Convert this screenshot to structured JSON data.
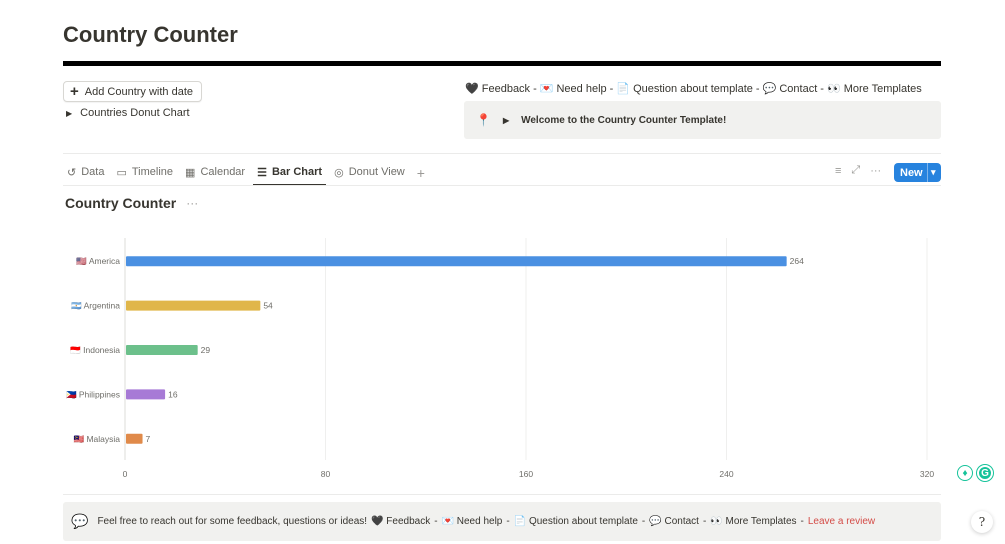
{
  "page": {
    "title": "Country Counter"
  },
  "actions": {
    "add_label": "Add Country with date",
    "toggle_label": "Countries Donut Chart"
  },
  "links": {
    "feedback": "🖤 Feedback",
    "need_help": "💌 Need help",
    "question": "📄 Question about template",
    "contact": "💬 Contact",
    "more_templates": "👀 More Templates",
    "separator": "-"
  },
  "callout_top": {
    "text": "Welcome to the Country Counter Template!"
  },
  "tabs": [
    {
      "label": "Data",
      "icon": "history-icon"
    },
    {
      "label": "Timeline",
      "icon": "timeline-icon"
    },
    {
      "label": "Calendar",
      "icon": "calendar-icon"
    },
    {
      "label": "Bar Chart",
      "icon": "bar-chart-icon"
    },
    {
      "label": "Donut View",
      "icon": "donut-icon"
    }
  ],
  "toolbar": {
    "new_label": "New"
  },
  "database": {
    "title": "Country Counter"
  },
  "chart_data": {
    "type": "bar",
    "orientation": "horizontal",
    "categories": [
      "🇺🇸 America",
      "🇦🇷 Argentina",
      "🇮🇩 Indonesia",
      "🇵🇭 Philippines",
      "🇲🇾 Malaysia"
    ],
    "values": [
      264,
      54,
      29,
      16,
      7
    ],
    "colors": [
      "#4a90e2",
      "#e0b64a",
      "#6cc08b",
      "#a77ad6",
      "#e08a4a"
    ],
    "xticks": [
      "0",
      "80",
      "160",
      "240",
      "320"
    ],
    "xlim": [
      0,
      320
    ],
    "grid": true,
    "legend": "none"
  },
  "callout_bottom": {
    "text": "Feel free to reach out for some feedback, questions or ideas!",
    "review": "Leave a review"
  }
}
